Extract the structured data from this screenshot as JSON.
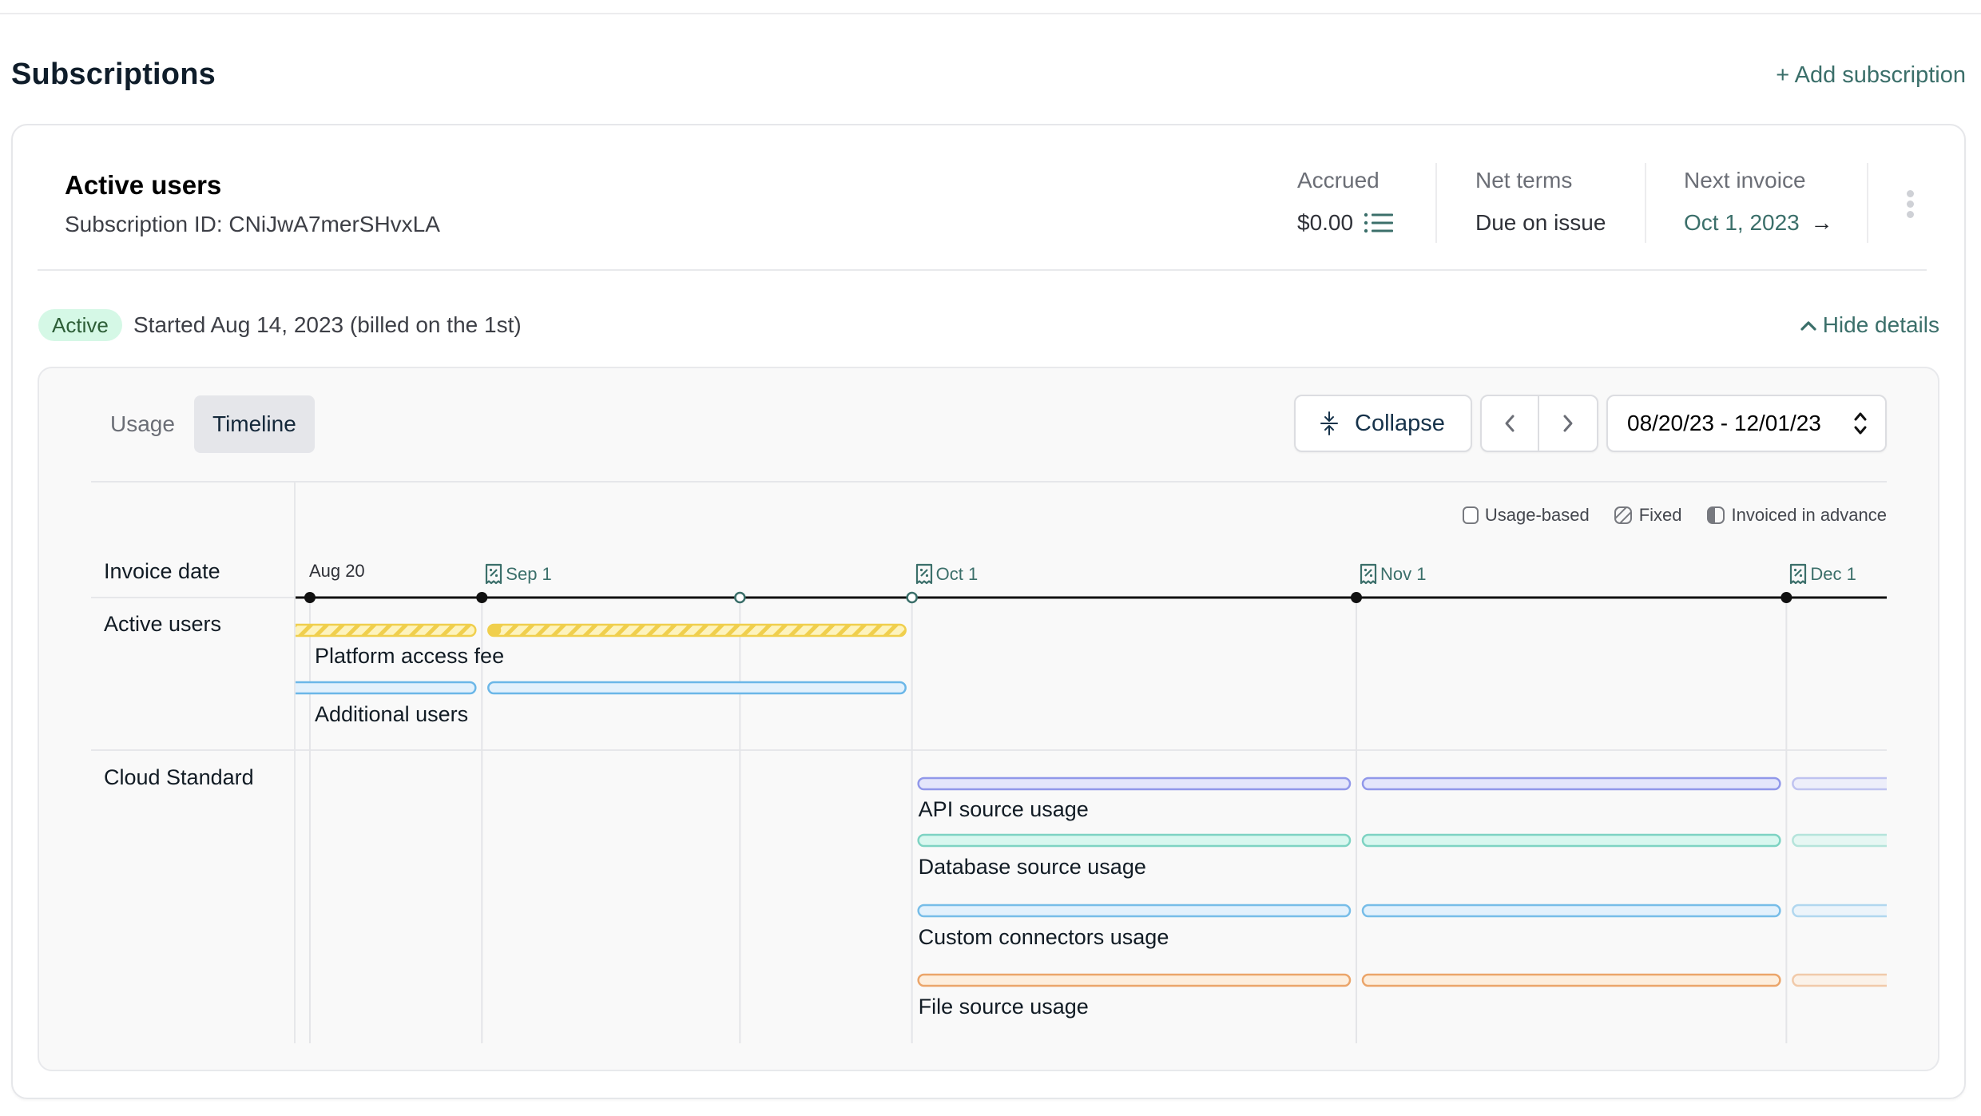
{
  "page": {
    "title": "Subscriptions",
    "add_subscription": "+ Add subscription"
  },
  "subscription": {
    "name": "Active users",
    "id_label": "Subscription ID: CNiJwA7merSHvxLA",
    "stats": {
      "accrued": {
        "label": "Accrued",
        "value": "$0.00",
        "icon": "list-icon"
      },
      "net_terms": {
        "label": "Net terms",
        "value": "Due on issue"
      },
      "next_invoice": {
        "label": "Next invoice",
        "value": "Oct 1, 2023",
        "arrow": "→"
      }
    },
    "status_badge": "Active",
    "started_text": "Started Aug 14, 2023 (billed on the 1st)",
    "hide_details": "Hide details",
    "colors": {
      "accent": "#3b6f6a",
      "badge_bg": "#d5f8e6",
      "badge_text": "#2d5e37"
    }
  },
  "details": {
    "tabs": [
      {
        "label": "Usage",
        "active": false
      },
      {
        "label": "Timeline",
        "active": true
      }
    ],
    "collapse_label": "Collapse",
    "prev_icon": "chevron-left-icon",
    "next_icon": "chevron-right-icon",
    "date_range": "08/20/23 - 12/01/23",
    "legend": [
      {
        "label": "Usage-based",
        "icon": "outline-box-icon"
      },
      {
        "label": "Fixed",
        "icon": "hatched-box-icon"
      },
      {
        "label": "Invoiced in advance",
        "icon": "half-filled-box-icon"
      }
    ]
  },
  "timeline": {
    "view_start": "2023-08-19",
    "view_end": "2023-12-08",
    "invoice_row_label": "Invoice date",
    "markers": [
      {
        "date": "2023-08-20",
        "label": "Aug 20",
        "invoice": false,
        "style": "filled"
      },
      {
        "date": "2023-09-01",
        "label": "Sep 1",
        "invoice": true,
        "style": "filled"
      },
      {
        "date": "2023-09-19",
        "label": "",
        "invoice": false,
        "style": "open"
      },
      {
        "date": "2023-10-01",
        "label": "Oct 1",
        "invoice": true,
        "style": "open"
      },
      {
        "date": "2023-11-01",
        "label": "Nov 1",
        "invoice": true,
        "style": "filled"
      },
      {
        "date": "2023-12-01",
        "label": "Dec 1",
        "invoice": true,
        "style": "filled"
      }
    ],
    "groups": [
      {
        "label": "Active users",
        "items": [
          {
            "label": "Platform access fee",
            "type": "fixed",
            "color": "#f0cf4d",
            "fill": "#fdf3bd",
            "periods": [
              {
                "start": "2023-08-14",
                "end": "2023-09-01"
              },
              {
                "start": "2023-09-01",
                "end": "2023-10-01",
                "advance": true
              }
            ]
          },
          {
            "label": "Additional users",
            "type": "usage",
            "color": "#6bb7e8",
            "fill": "#e3f1fc",
            "periods": [
              {
                "start": "2023-08-14",
                "end": "2023-09-01"
              },
              {
                "start": "2023-09-01",
                "end": "2023-10-01"
              }
            ]
          }
        ]
      },
      {
        "label": "Cloud Standard",
        "items": [
          {
            "label": "API source usage",
            "type": "usage",
            "color": "#9198ea",
            "fill": "#e4e6fb",
            "periods": [
              {
                "start": "2023-10-01",
                "end": "2023-11-01"
              },
              {
                "start": "2023-11-01",
                "end": "2023-12-01"
              },
              {
                "start": "2023-12-01",
                "end": "2024-01-01",
                "faded": true
              }
            ]
          },
          {
            "label": "Database source usage",
            "type": "usage",
            "color": "#7ed3c3",
            "fill": "#d8f7ef",
            "periods": [
              {
                "start": "2023-10-01",
                "end": "2023-11-01"
              },
              {
                "start": "2023-11-01",
                "end": "2023-12-01"
              },
              {
                "start": "2023-12-01",
                "end": "2024-01-01",
                "faded": true
              }
            ]
          },
          {
            "label": "Custom connectors usage",
            "type": "usage",
            "color": "#77bde8",
            "fill": "#e3f1fc",
            "periods": [
              {
                "start": "2023-10-01",
                "end": "2023-11-01"
              },
              {
                "start": "2023-11-01",
                "end": "2023-12-01"
              },
              {
                "start": "2023-12-01",
                "end": "2024-01-01",
                "faded": true
              }
            ]
          },
          {
            "label": "File source usage",
            "type": "usage",
            "color": "#eba56a",
            "fill": "#fdeedd",
            "periods": [
              {
                "start": "2023-10-01",
                "end": "2023-11-01"
              },
              {
                "start": "2023-11-01",
                "end": "2023-12-01"
              },
              {
                "start": "2023-12-01",
                "end": "2024-01-01",
                "faded": true
              }
            ]
          }
        ]
      }
    ]
  }
}
